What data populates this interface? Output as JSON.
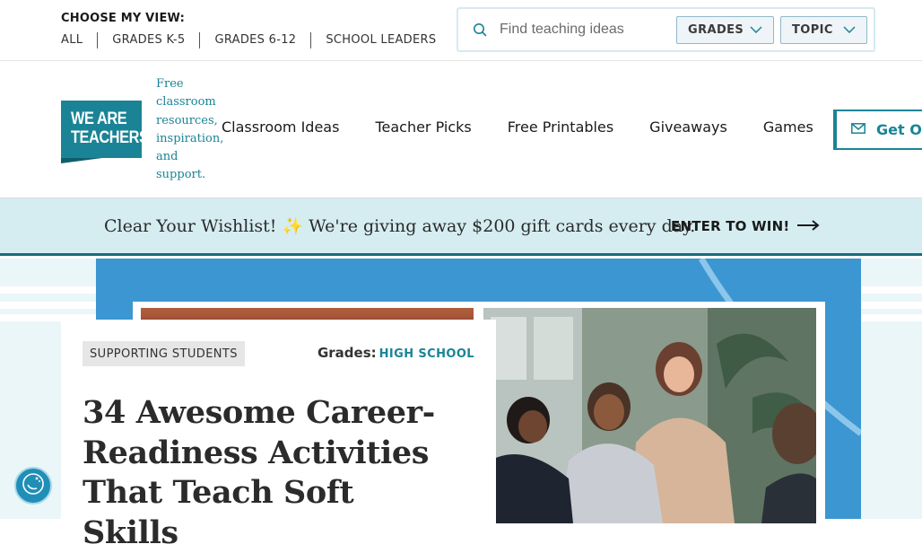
{
  "topbar": {
    "view_title": "CHOOSE MY VIEW:",
    "view_links": [
      "ALL",
      "GRADES K-5",
      "GRADES 6-12",
      "SCHOOL LEADERS"
    ],
    "search": {
      "placeholder": "Find teaching ideas",
      "value": ""
    },
    "grades_dropdown": "GRADES",
    "topic_dropdown": "TOPIC"
  },
  "brand": {
    "logo_line1": "WE ARE",
    "logo_line2": "TEACHERS",
    "tagline": "Free classroom resources, inspiration, and support.",
    "color": "#1a8496"
  },
  "nav": {
    "items": [
      "Classroom Ideas",
      "Teacher Picks",
      "Free Printables",
      "Giveaways",
      "Games"
    ],
    "newsletter_label": "Get Ou"
  },
  "promo": {
    "text": "Clear Your Wishlist! ✨ We're giving away $200 gift cards every day.",
    "cta": "ENTER TO WIN!"
  },
  "article": {
    "category": "SUPPORTING STUDENTS",
    "grades_label": "Grades:",
    "grades_value": "HIGH SCHOOL",
    "title": "34 Awesome Career-Readiness Activities That Teach Soft Skills"
  },
  "icons": {
    "search": "search-icon",
    "chevron": "chevron-down-icon",
    "mail": "mail-icon",
    "arrow": "arrow-right-icon",
    "accessibility": "accessibility-icon"
  }
}
